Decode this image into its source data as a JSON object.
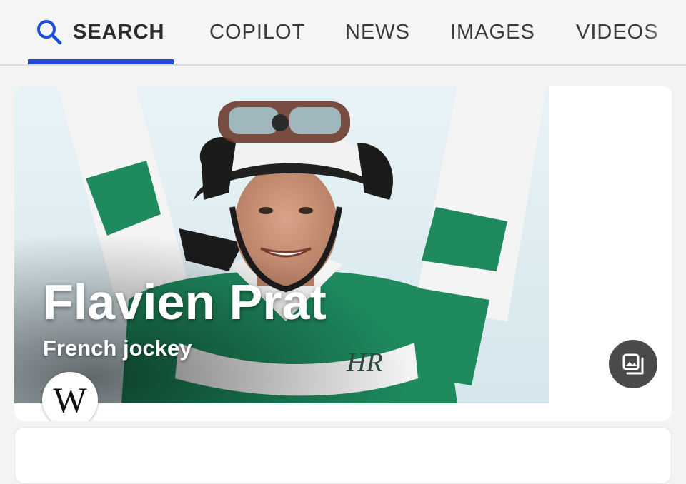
{
  "tabs": [
    {
      "label": "SEARCH",
      "active": true,
      "icon": "search-icon"
    },
    {
      "label": "COPILOT",
      "active": false
    },
    {
      "label": "NEWS",
      "active": false
    },
    {
      "label": "IMAGES",
      "active": false
    },
    {
      "label": "VIDEOS",
      "active": false
    }
  ],
  "colors": {
    "accent": "#1a4ed8",
    "jersey_green": "#1e8a5e"
  },
  "entity": {
    "name": "Flavien Prat",
    "description": "French jockey",
    "source_icon": "wikipedia-icon",
    "source_glyph": "W",
    "jersey_monogram": "HR",
    "gallery_icon": "image-gallery-icon"
  }
}
